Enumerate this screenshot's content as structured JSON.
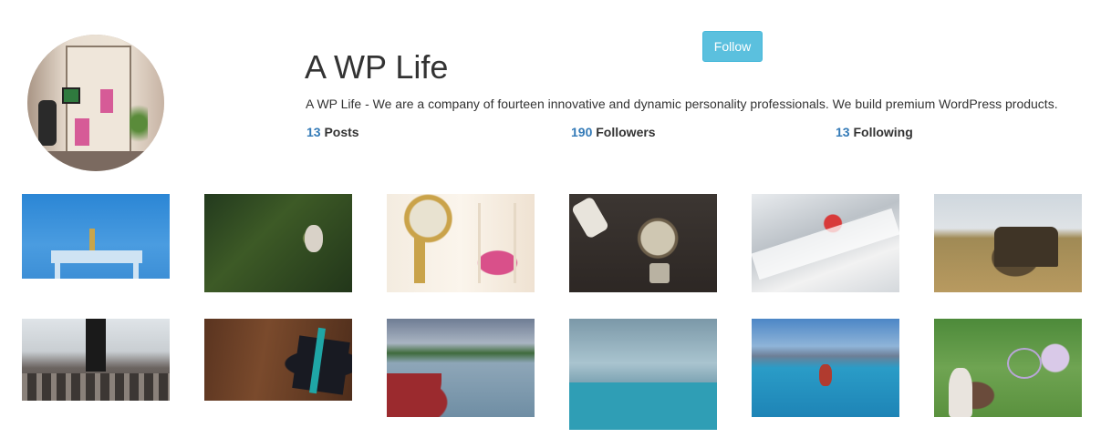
{
  "profile": {
    "name": "A WP Life",
    "bio": "A WP Life - We are a company of fourteen innovative and dynamic personality professionals. We build premium WordPress products.",
    "follow_label": "Follow",
    "stats": {
      "posts": {
        "count": "13",
        "label": "Posts"
      },
      "followers": {
        "count": "190",
        "label": "Followers"
      },
      "following": {
        "count": "13",
        "label": "Following"
      }
    }
  },
  "colors": {
    "follow_button": "#5bc0de",
    "stat_number": "#337ab7"
  },
  "gallery": [
    {
      "subject": "table on blue background"
    },
    {
      "subject": "rabbit in grass"
    },
    {
      "subject": "clock and hourglass"
    },
    {
      "subject": "light bulb and plug"
    },
    {
      "subject": "gnome on snowy branch"
    },
    {
      "subject": "old truck in field"
    },
    {
      "subject": "person on railway tracks"
    },
    {
      "subject": "gift box on wood"
    },
    {
      "subject": "canoe on lake"
    },
    {
      "subject": "marble caves"
    },
    {
      "subject": "kayak on mountain lake"
    },
    {
      "subject": "girl with soap bubble"
    }
  ]
}
